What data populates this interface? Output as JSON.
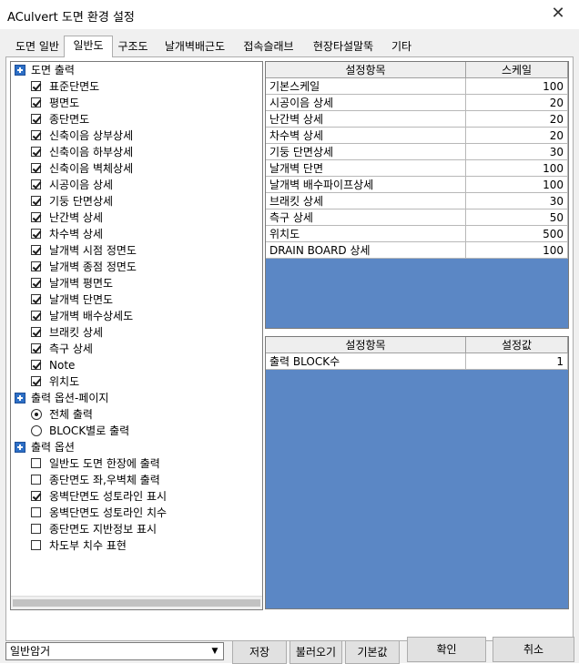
{
  "window": {
    "title": "ACulvert 도면 환경 설정",
    "close_glyph": "✕"
  },
  "tabs": [
    {
      "label": "도면 일반"
    },
    {
      "label": "일반도",
      "active": true
    },
    {
      "label": "구조도"
    },
    {
      "label": "날개벽배근도"
    },
    {
      "label": "접속슬래브"
    },
    {
      "label": "현장타설말뚝"
    },
    {
      "label": "기타"
    }
  ],
  "tree": {
    "categories": [
      {
        "label": "도면 출력",
        "icon": "category-expand-icon"
      },
      {
        "label": "출력 옵션-페이지",
        "icon": "category-expand-icon"
      },
      {
        "label": "출력 옵션",
        "icon": "category-expand-icon"
      }
    ],
    "drawing_output": [
      {
        "label": "표준단면도",
        "checked": true
      },
      {
        "label": "평면도",
        "checked": true
      },
      {
        "label": "종단면도",
        "checked": true
      },
      {
        "label": "신축이음 상부상세",
        "checked": true
      },
      {
        "label": "신축이음 하부상세",
        "checked": true
      },
      {
        "label": "신축이음 벽체상세",
        "checked": true
      },
      {
        "label": "시공이음 상세",
        "checked": true
      },
      {
        "label": "기둥 단면상세",
        "checked": true
      },
      {
        "label": "난간벽 상세",
        "checked": true
      },
      {
        "label": "차수벽 상세",
        "checked": true
      },
      {
        "label": "날개벽 시점 정면도",
        "checked": true
      },
      {
        "label": "날개벽 종점 정면도",
        "checked": true
      },
      {
        "label": "날개벽 평면도",
        "checked": true
      },
      {
        "label": "날개벽 단면도",
        "checked": true
      },
      {
        "label": "날개벽 배수상세도",
        "checked": true
      },
      {
        "label": "브래킷 상세",
        "checked": true
      },
      {
        "label": "측구 상세",
        "checked": true
      },
      {
        "label": "Note",
        "checked": true
      },
      {
        "label": "위치도",
        "checked": true
      }
    ],
    "page_options": [
      {
        "label": "전체 출력",
        "checked": true
      },
      {
        "label": "BLOCK별로 출력",
        "checked": false
      }
    ],
    "output_options": [
      {
        "label": "일반도 도면 한장에 출력",
        "checked": false
      },
      {
        "label": "종단면도 좌,우벽체 출력",
        "checked": false
      },
      {
        "label": "옹벽단면도 성토라인 표시",
        "checked": true
      },
      {
        "label": "옹벽단면도 성토라인 치수",
        "checked": false
      },
      {
        "label": "종단면도 지반정보 표시",
        "checked": false
      },
      {
        "label": "차도부 치수 표현",
        "checked": false
      }
    ]
  },
  "scale_grid": {
    "headers": [
      "설정항목",
      "스케일"
    ],
    "rows": [
      {
        "item": "기본스케일",
        "value": "100"
      },
      {
        "item": "시공이음 상세",
        "value": "20"
      },
      {
        "item": "난간벽 상세",
        "value": "20"
      },
      {
        "item": "차수벽 상세",
        "value": "20"
      },
      {
        "item": "기둥 단면상세",
        "value": "30"
      },
      {
        "item": "날개벽 단면",
        "value": "100"
      },
      {
        "item": "날개벽 배수파이프상세",
        "value": "100"
      },
      {
        "item": "브래킷 상세",
        "value": "30"
      },
      {
        "item": "측구 상세",
        "value": "50"
      },
      {
        "item": "위치도",
        "value": "500"
      },
      {
        "item": "DRAIN BOARD 상세",
        "value": "100"
      }
    ]
  },
  "setting_grid": {
    "headers": [
      "설정항목",
      "설정값"
    ],
    "rows": [
      {
        "item": "출력 BLOCK수",
        "value": "1"
      }
    ]
  },
  "bottom": {
    "preset_value": "일반암거",
    "preset_arrow": "▼",
    "save_label": "저장",
    "load_label": "불러오기",
    "default_label": "기본값",
    "ok_label": "확인",
    "cancel_label": "취소"
  }
}
